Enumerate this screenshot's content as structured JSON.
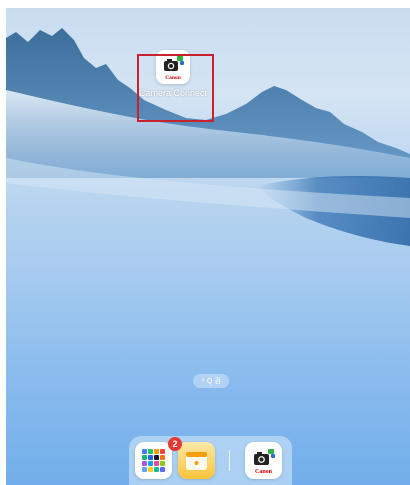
{
  "home_screen": {
    "app": {
      "label": "Camera Connect",
      "icon_brand_text": "Canon",
      "icon": "canon-camera-connect-icon"
    },
    "page_indicator": {
      "text": "Q 검 ",
      "icon": "search-icon"
    },
    "dock": {
      "apps": [
        {
          "name": "App Library",
          "icon": "app-library-icon",
          "badge": "2"
        },
        {
          "name": "Notes",
          "icon": "notes-icon"
        },
        {
          "name": "Camera Connect",
          "icon": "canon-camera-connect-icon",
          "brand_text": "Canon"
        }
      ]
    }
  },
  "colors": {
    "highlight": "#c8222e",
    "badge": "#e53935",
    "canon_red": "#cc0000"
  }
}
